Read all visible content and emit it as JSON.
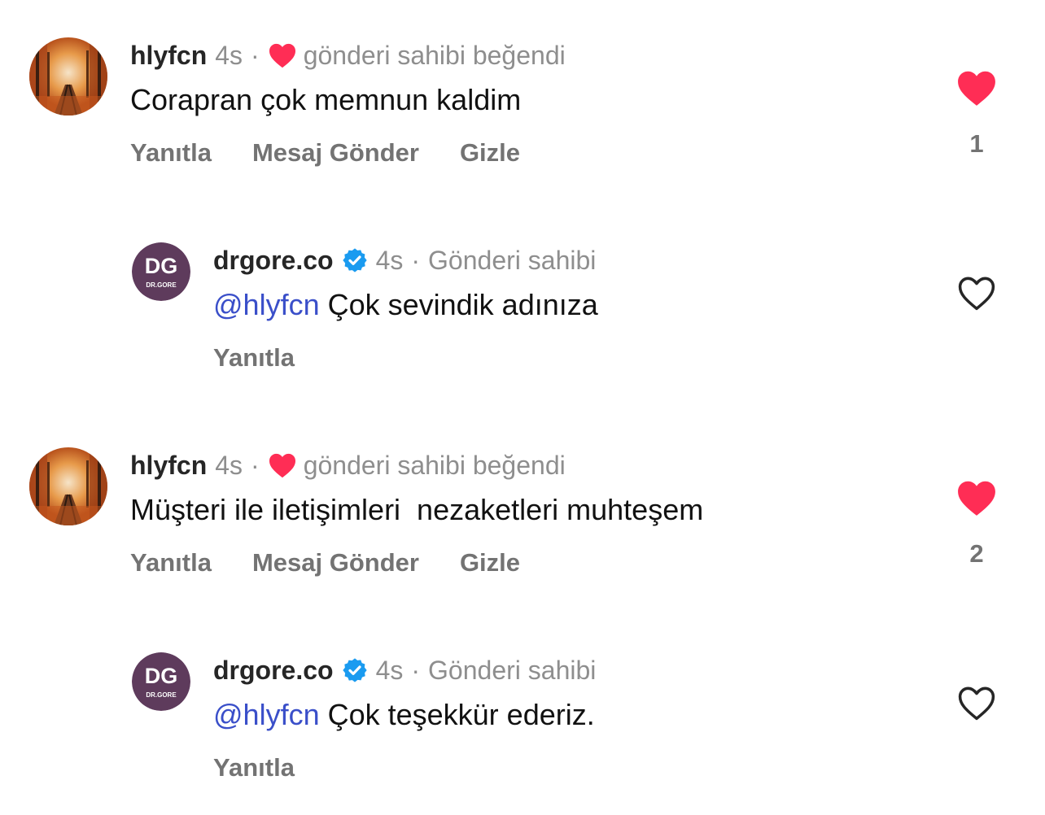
{
  "colors": {
    "like_red": "#ff2d55",
    "verified_blue": "#1a9bf0",
    "mention_blue": "#3a4fc9",
    "brand_purple": "#5e3b5c"
  },
  "comments": [
    {
      "username": "hlyfcn",
      "time": "4s",
      "separator": "·",
      "owner_liked_icon": "heart-icon",
      "owner_liked_text": "gönderi sahibi beğendi",
      "text": "Corapran çok memnun kaldim",
      "actions": [
        "Yanıtla",
        "Mesaj Gönder",
        "Gizle"
      ],
      "liked": true,
      "like_count": "1"
    },
    {
      "username": "drgore.co",
      "verified_icon": "verified-badge-icon",
      "time": "4s",
      "separator": "·",
      "owner_text": "Gönderi sahibi",
      "avatar_text": "DG",
      "avatar_subtext": "DR.GORE",
      "mention": "@hlyfcn",
      "text": " Çok sevindik adınıza",
      "actions": [
        "Yanıtla"
      ],
      "liked": false
    },
    {
      "username": "hlyfcn",
      "time": "4s",
      "separator": "·",
      "owner_liked_icon": "heart-icon",
      "owner_liked_text": "gönderi sahibi beğendi",
      "text": "Müşteri ile iletişimleri  nezaketleri muhteşem",
      "actions": [
        "Yanıtla",
        "Mesaj Gönder",
        "Gizle"
      ],
      "liked": true,
      "like_count": "2"
    },
    {
      "username": "drgore.co",
      "verified_icon": "verified-badge-icon",
      "time": "4s",
      "separator": "·",
      "owner_text": "Gönderi sahibi",
      "avatar_text": "DG",
      "avatar_subtext": "DR.GORE",
      "mention": "@hlyfcn",
      "text": " Çok teşekkür ederiz.",
      "actions": [
        "Yanıtla"
      ],
      "liked": false
    }
  ]
}
